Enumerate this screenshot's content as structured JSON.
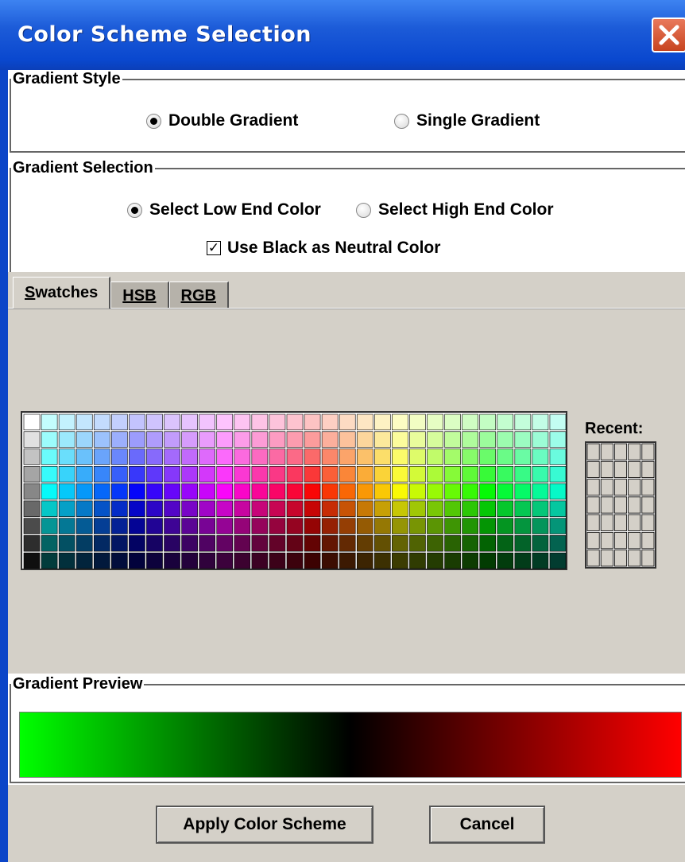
{
  "window": {
    "title": "Color Scheme Selection"
  },
  "gradient_style": {
    "legend": "Gradient Style",
    "options": [
      {
        "label": "Double Gradient",
        "selected": true
      },
      {
        "label": "Single Gradient",
        "selected": false
      }
    ]
  },
  "gradient_selection": {
    "legend": "Gradient Selection",
    "options": [
      {
        "label": "Select Low End Color",
        "selected": true
      },
      {
        "label": "Select High End Color",
        "selected": false
      }
    ],
    "neutral_checkbox": {
      "label": "Use Black as Neutral Color",
      "checked": true
    }
  },
  "color_chooser": {
    "tabs": [
      {
        "label": "Swatches",
        "mnemonic": "S",
        "active": true
      },
      {
        "label": "HSB",
        "mnemonic": "H",
        "active": false
      },
      {
        "label": "RGB",
        "mnemonic": "G",
        "active": false
      }
    ],
    "recent_label": "Recent:",
    "swatch_grid": {
      "columns": 31,
      "rows": 9
    },
    "recent_grid": {
      "columns": 5,
      "rows": 7
    }
  },
  "preview": {
    "legend": "Gradient Preview",
    "gradient_colors": [
      "#00ff00",
      "#000000",
      "#ff0000"
    ]
  },
  "buttons": {
    "apply": "Apply Color Scheme",
    "cancel": "Cancel"
  }
}
